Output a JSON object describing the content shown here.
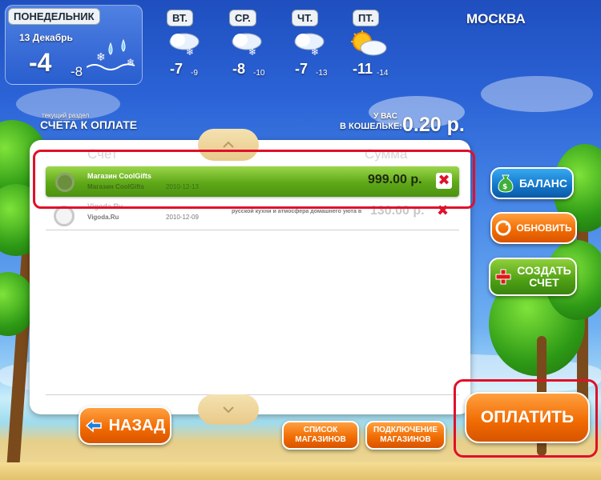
{
  "city": "МОСКВА",
  "today": {
    "day": "ПОНЕДЕЛЬНИК",
    "date": "13 Декабрь",
    "temp_high": "-4",
    "temp_low": "-8"
  },
  "forecast": [
    {
      "day": "ВТ.",
      "high": "-7",
      "low": "-9",
      "icon": "cloud-snow-icon"
    },
    {
      "day": "СР.",
      "high": "-8",
      "low": "-10",
      "icon": "cloud-snow-icon"
    },
    {
      "day": "ЧТ.",
      "high": "-7",
      "low": "-13",
      "icon": "cloud-snow-icon"
    },
    {
      "day": "ПТ.",
      "high": "-11",
      "low": "-14",
      "icon": "sun-cloud-icon"
    }
  ],
  "section": {
    "caption": "текущий раздел",
    "title": "СЧЕТА К ОПЛАТЕ"
  },
  "wallet": {
    "label_line1": "У ВАС",
    "label_line2": "В КОШЕЛЬКЕ:",
    "amount": "0.20 р."
  },
  "table": {
    "col_account": "Счет",
    "col_sum": "Сумма",
    "rows": [
      {
        "title": "Магазин CoolGifts",
        "subtitle": "Магазин CoolGifts",
        "date": "2010-12-13",
        "amount": "999.00 р.",
        "desc": "",
        "selected": true
      },
      {
        "title": "Vigoda.Ru",
        "subtitle": "Vigoda.Ru",
        "date": "2010-12-09",
        "amount": "130.00 р.",
        "desc": "русской кухни и атмосфера домашнего уюта в",
        "selected": false
      }
    ]
  },
  "buttons": {
    "balance": "БАЛАНС",
    "refresh": "ОБНОВИТЬ",
    "create_line1": "СОЗДАТЬ",
    "create_line2": "СЧЕТ",
    "back": "НАЗАД",
    "shops_line1": "СПИСОК",
    "shops_line2": "МАГАЗИНОВ",
    "connect_line1": "ПОДКЛЮЧЕНИЕ",
    "connect_line2": "МАГАЗИНОВ",
    "pay": "ОПЛАТИТЬ"
  },
  "colors": {
    "accent_orange": "#f06a00",
    "accent_green": "#4fa014",
    "highlight_red": "#e0102a",
    "delete_red": "#e0102a"
  }
}
